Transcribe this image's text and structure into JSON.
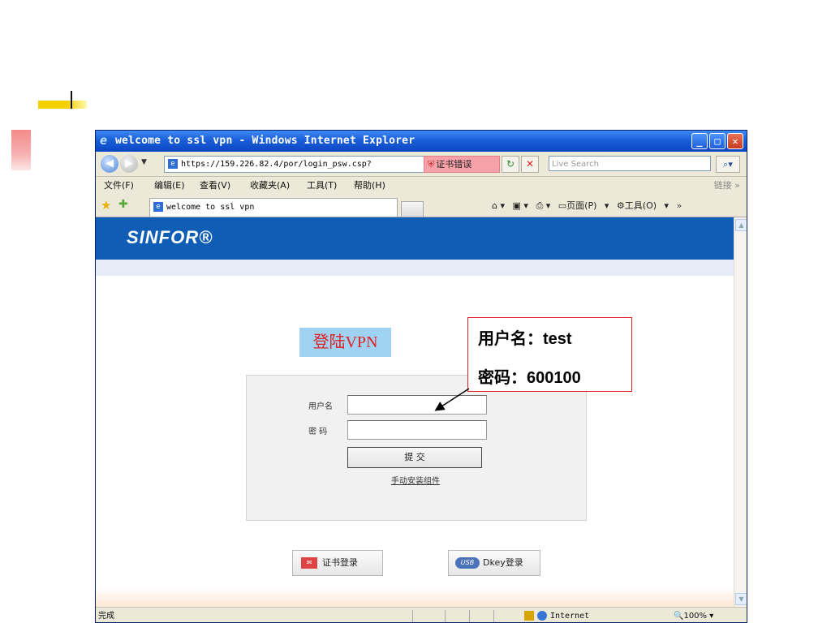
{
  "window": {
    "title": "welcome to ssl vpn - Windows Internet Explorer",
    "controls": {
      "minimize": "_",
      "maximize": "□",
      "close": "✕"
    }
  },
  "toolbar": {
    "address": "https://159.226.82.4/por/login_psw.csp?",
    "cert_error": "证书错误",
    "live_search_placeholder": "Live Search"
  },
  "menu": {
    "items": [
      "文件(F)",
      "编辑(E)",
      "查看(V)",
      "收藏夹(A)",
      "工具(T)",
      "帮助(H)"
    ],
    "links": "链接 »"
  },
  "tabs": {
    "active": "welcome to ssl vpn",
    "tools": [
      "页面(P)",
      "工具(O)"
    ]
  },
  "page": {
    "logo": "SINFOR®",
    "vpn_label": "登陆VPN",
    "form": {
      "username_label": "用户名",
      "password_label": "密 码",
      "username_value": "",
      "password_value": "",
      "submit_label": "提 交",
      "manual_install": "手动安装组件"
    },
    "cert_login": "证书登录",
    "dkey_login": "Dkey登录"
  },
  "statusbar": {
    "status": "完成",
    "zone": "Internet",
    "zoom": "100%"
  },
  "annotation": {
    "line1": "用户名：test",
    "line2": "密码：600100"
  }
}
